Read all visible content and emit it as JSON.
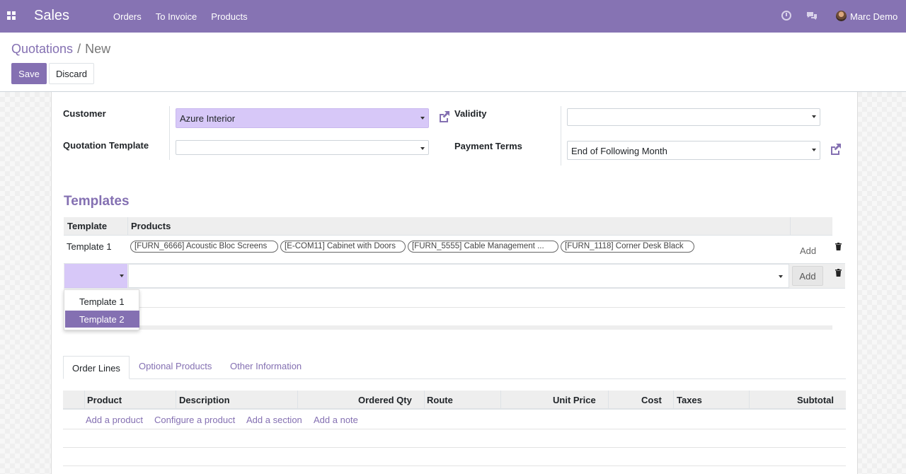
{
  "navbar": {
    "app_name": "Sales",
    "menu": [
      "Orders",
      "To Invoice",
      "Products"
    ],
    "user_name": "Marc Demo"
  },
  "breadcrumb": {
    "parent": "Quotations",
    "separator": "/",
    "current": "New"
  },
  "buttons": {
    "save": "Save",
    "discard": "Discard"
  },
  "form": {
    "customer_label": "Customer",
    "customer_value": "Azure Interior",
    "quotation_template_label": "Quotation Template",
    "quotation_template_value": "",
    "validity_label": "Validity",
    "validity_value": "",
    "payment_terms_label": "Payment Terms",
    "payment_terms_value": "End of Following Month"
  },
  "templates": {
    "title": "Templates",
    "columns": [
      "Template",
      "Products"
    ],
    "rows": [
      {
        "template": "Template 1",
        "products": [
          "[FURN_6666] Acoustic Bloc Screens",
          "[E-COM11] Cabinet with Doors",
          "[FURN_5555] Cable Management ...",
          "[FURN_1118] Corner Desk Black"
        ],
        "add_label": "Add"
      }
    ],
    "edit_row": {
      "template_value": "",
      "products_value": "",
      "add_label": "Add"
    },
    "dropdown_options": [
      "Template 1",
      "Template 2"
    ],
    "dropdown_highlighted": "Template 2"
  },
  "tabs": [
    "Order Lines",
    "Optional Products",
    "Other Information"
  ],
  "active_tab": "Order Lines",
  "order_lines": {
    "columns": [
      "Product",
      "Description",
      "Ordered Qty",
      "Route",
      "Unit Price",
      "Cost",
      "Taxes",
      "Subtotal"
    ],
    "actions": [
      "Add a product",
      "Configure a product",
      "Add a section",
      "Add a note"
    ]
  },
  "colors": {
    "brand": "#8673b3",
    "accent_link": "#8470b2",
    "selected_field": "#d7c8f8"
  }
}
